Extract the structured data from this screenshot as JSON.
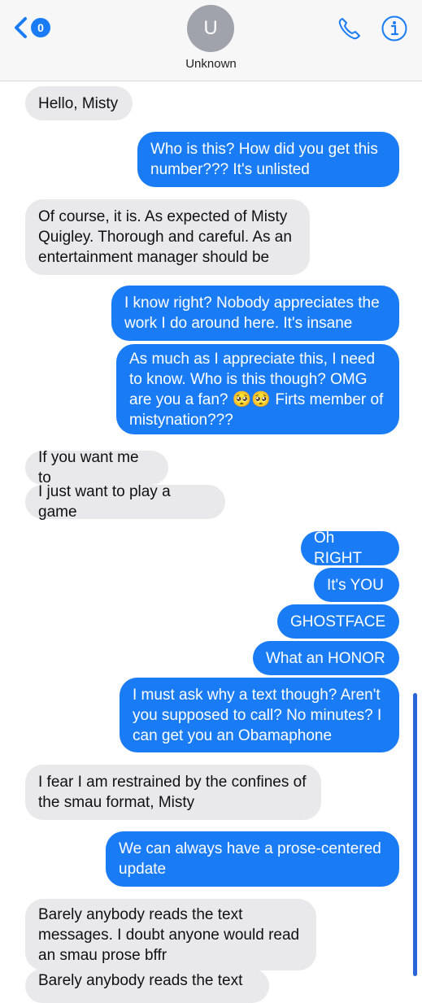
{
  "header": {
    "badge": "0",
    "avatar_initial": "U",
    "contact_name": "Unknown",
    "accent_color": "#1a7cf5",
    "icons": [
      "chevron-left-icon",
      "phone-icon",
      "info-icon"
    ]
  },
  "messages": [
    {
      "dir": "in",
      "text": "Hello, Misty"
    },
    {
      "dir": "out",
      "text": "Who is this? How did you get this number??? It's unlisted"
    },
    {
      "dir": "in",
      "text": "Of course, it is. As expected of Misty Quigley. Thorough and careful. As an entertainment manager should be"
    },
    {
      "dir": "out",
      "text": "I know right? Nobody appreciates the work I do around here. It's insane"
    },
    {
      "dir": "out",
      "text": "As much as I appreciate this, I need to know. Who is this though? OMG are you a fan? 🥺🥺 Firts member of mistynation???"
    },
    {
      "dir": "in",
      "text": "If you want me to"
    },
    {
      "dir": "in",
      "text": "I just want to play a game"
    },
    {
      "dir": "out",
      "text": "Oh RIGHT"
    },
    {
      "dir": "out",
      "text": "It's YOU"
    },
    {
      "dir": "out",
      "text": "GHOSTFACE"
    },
    {
      "dir": "out",
      "text": "What an HONOR"
    },
    {
      "dir": "out",
      "text": "I must ask why a text though? Aren't you supposed to call? No minutes? I can get you an Obamaphone"
    },
    {
      "dir": "in",
      "text": "I fear I am restrained by the confines of the smau format, Misty"
    },
    {
      "dir": "out",
      "text": "We can always have a prose-centered update"
    },
    {
      "dir": "in",
      "text": "Barely anybody reads the text messages. I doubt anyone would read an smau prose bffr"
    },
    {
      "dir": "in",
      "text": "Barely anybody reads the text"
    }
  ]
}
